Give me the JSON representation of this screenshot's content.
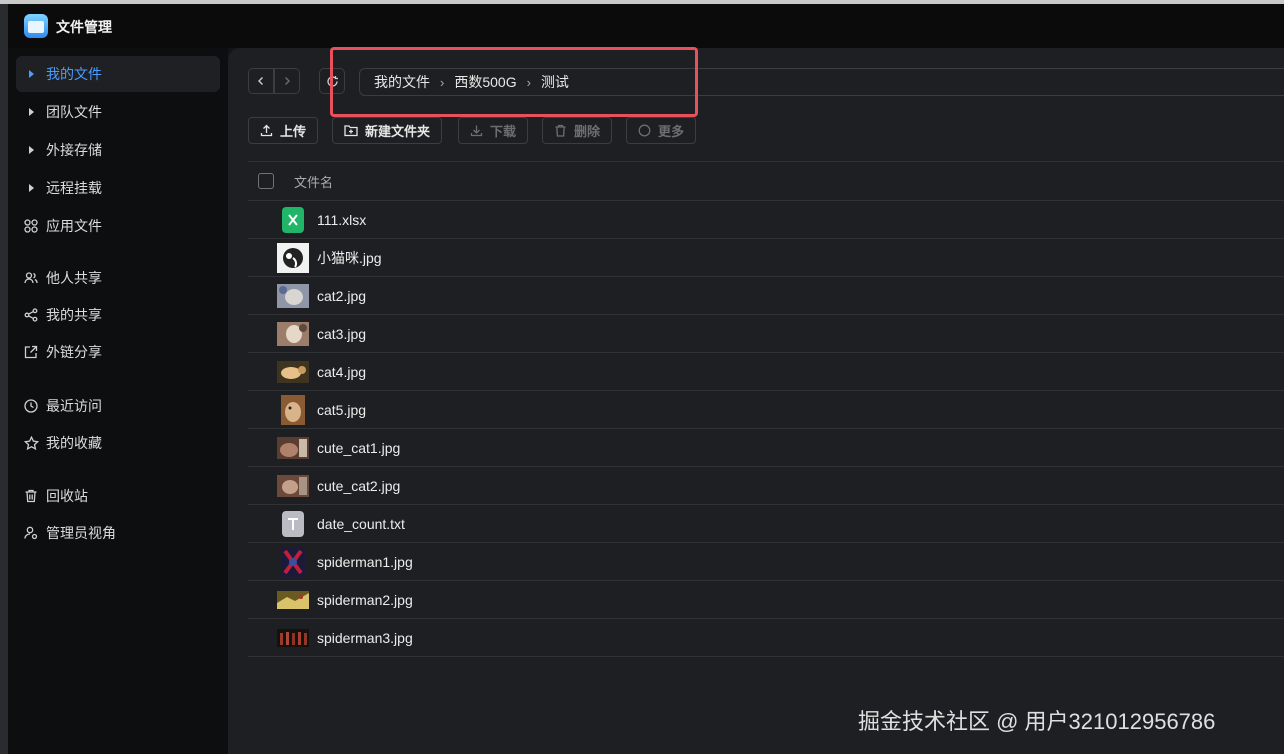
{
  "app": {
    "title": "文件管理"
  },
  "sidebar": {
    "items": [
      {
        "label": "我的文件"
      },
      {
        "label": "团队文件"
      },
      {
        "label": "外接存储"
      },
      {
        "label": "远程挂载"
      },
      {
        "label": "应用文件"
      },
      {
        "label": "他人共享"
      },
      {
        "label": "我的共享"
      },
      {
        "label": "外链分享"
      },
      {
        "label": "最近访问"
      },
      {
        "label": "我的收藏"
      },
      {
        "label": "回收站"
      },
      {
        "label": "管理员视角"
      }
    ]
  },
  "breadcrumb": [
    "我的文件",
    "西数500G",
    "测试"
  ],
  "toolbar": {
    "upload": "上传",
    "new_folder": "新建文件夹",
    "download": "下载",
    "delete": "删除",
    "more": "更多"
  },
  "table": {
    "header_name": "文件名",
    "rows": [
      {
        "name": "111.xlsx",
        "icon": "excel-file-icon"
      },
      {
        "name": "小猫咪.jpg",
        "icon": "image-thumbnail"
      },
      {
        "name": "cat2.jpg",
        "icon": "image-thumbnail"
      },
      {
        "name": "cat3.jpg",
        "icon": "image-thumbnail"
      },
      {
        "name": "cat4.jpg",
        "icon": "image-thumbnail"
      },
      {
        "name": "cat5.jpg",
        "icon": "image-thumbnail"
      },
      {
        "name": "cute_cat1.jpg",
        "icon": "image-thumbnail"
      },
      {
        "name": "cute_cat2.jpg",
        "icon": "image-thumbnail"
      },
      {
        "name": "date_count.txt",
        "icon": "text-file-icon"
      },
      {
        "name": "spiderman1.jpg",
        "icon": "image-thumbnail"
      },
      {
        "name": "spiderman2.jpg",
        "icon": "image-thumbnail"
      },
      {
        "name": "spiderman3.jpg",
        "icon": "image-thumbnail"
      }
    ]
  },
  "watermark": "掘金技术社区 @ 用户321012956786",
  "colors": {
    "accent": "#4c9bff",
    "highlight": "#e8505b"
  }
}
